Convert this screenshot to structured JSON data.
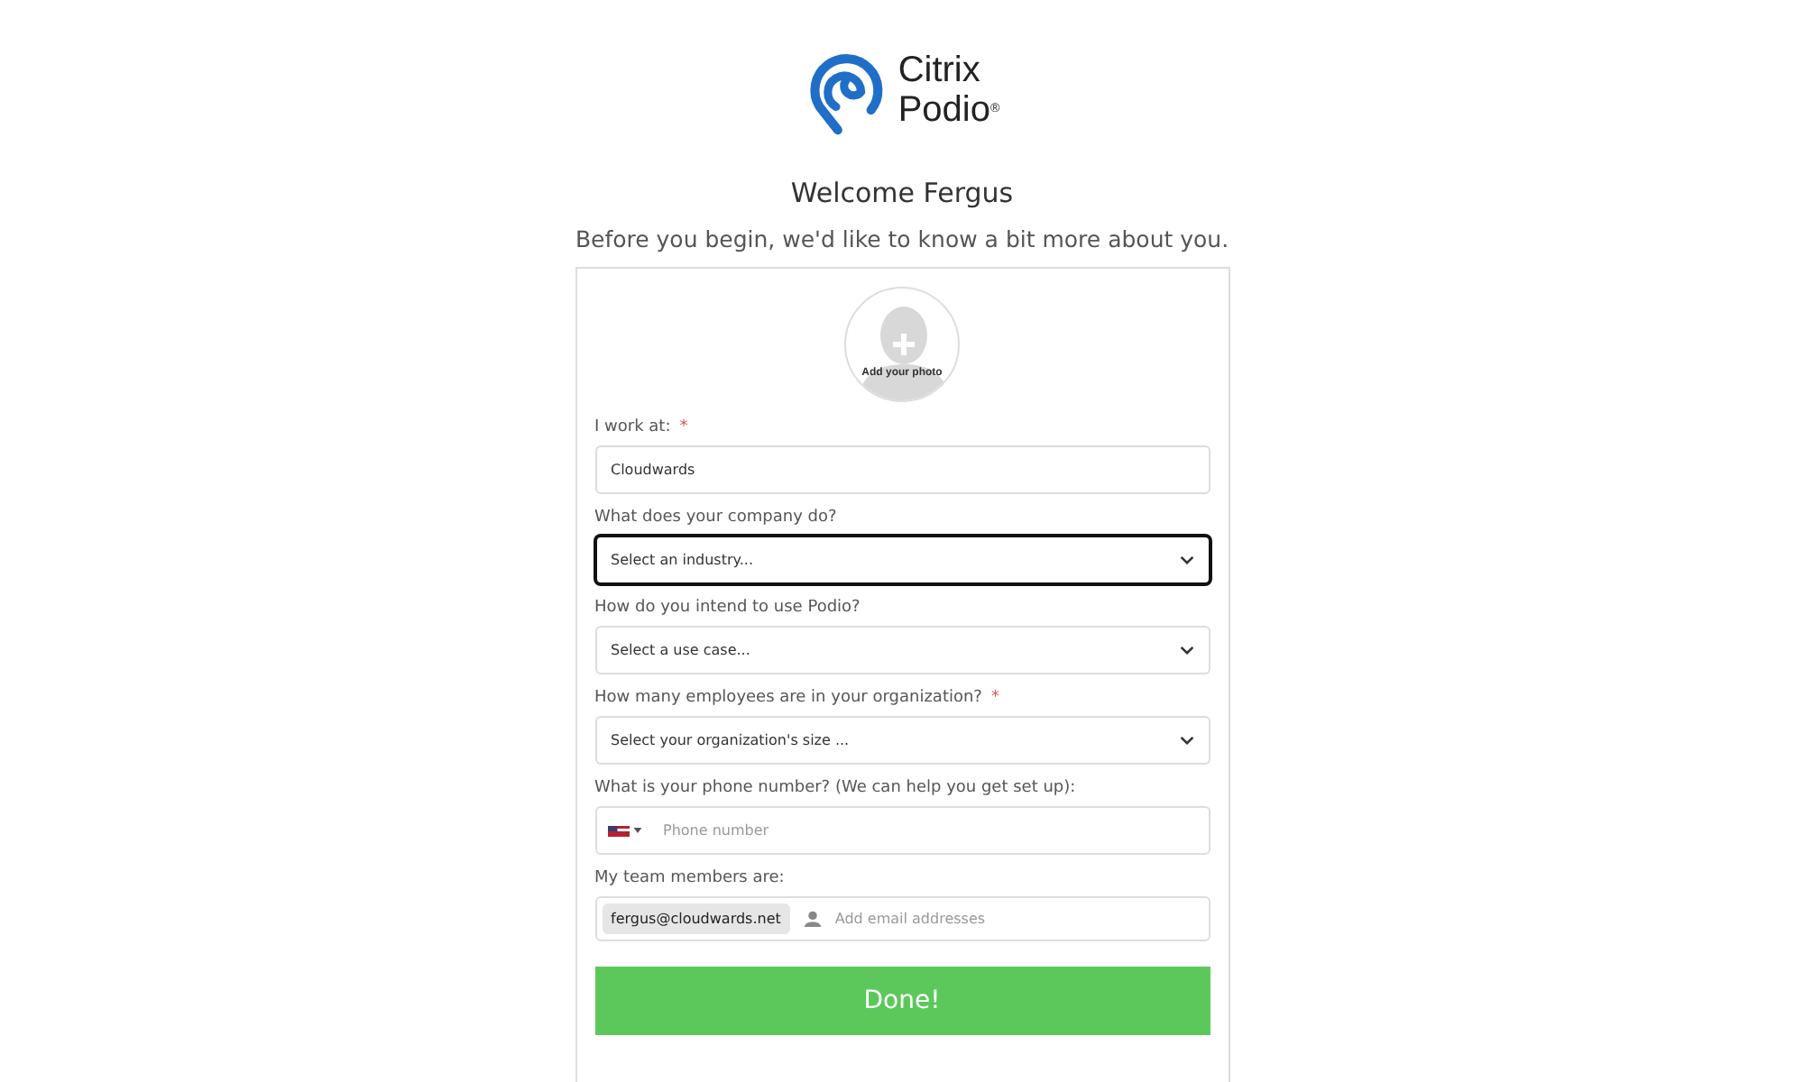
{
  "logo": {
    "line_1": "Citrix",
    "line_2": "Podio",
    "mark": "®"
  },
  "heading": "Welcome Fergus",
  "subtitle": "Before you begin, we'd like to know a bit more about you.",
  "photo": {
    "label": "Add your photo"
  },
  "fields": [
    {
      "kind": "text",
      "label": "I work at:",
      "required_mark": "*",
      "value": "Cloudwards",
      "focused": false
    },
    {
      "kind": "select",
      "label": "What does your company do?",
      "value": "Select an industry...",
      "focused": true
    },
    {
      "kind": "select",
      "label": "How do you intend to use Podio?",
      "value": "Select a use case...",
      "focused": false
    },
    {
      "kind": "select",
      "label": "How many employees are in your organization?",
      "required_mark": "*",
      "value": "Select your organization's size ...",
      "focused": false
    },
    {
      "kind": "phone",
      "label": "What is your phone number? (We can help you get set up):",
      "placeholder": "Phone number",
      "focused": false
    },
    {
      "kind": "tags",
      "label": "My team members are:",
      "tags": [
        "fergus@cloudwards.net"
      ],
      "placeholder": "Add email addresses",
      "focused": false
    }
  ],
  "submit": "Done!"
}
